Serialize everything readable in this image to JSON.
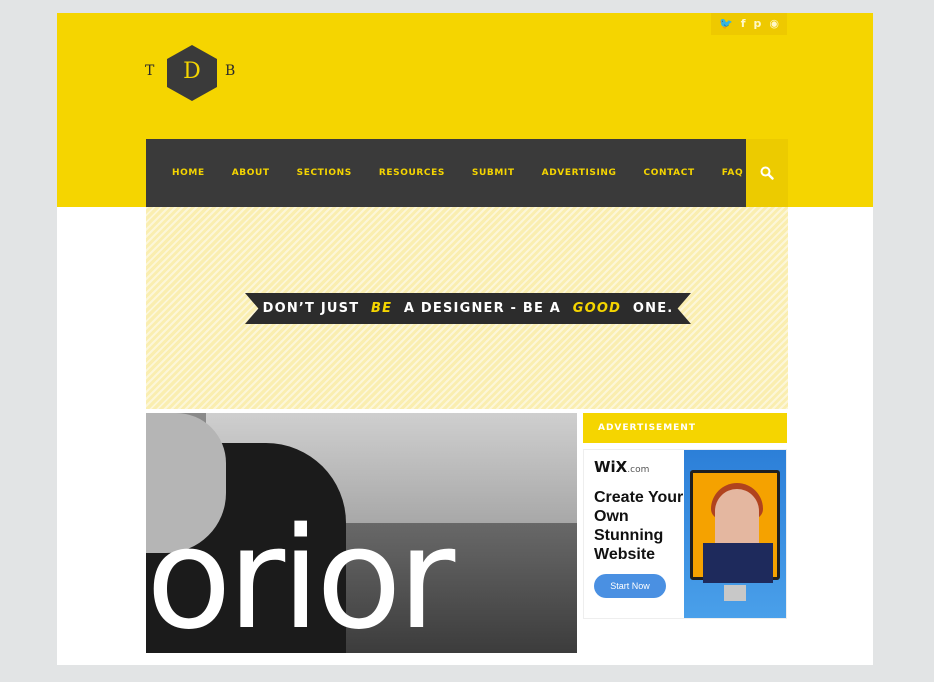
{
  "social": {
    "icons": [
      "twitter-icon",
      "facebook-icon",
      "pinterest-icon",
      "rss-icon"
    ],
    "glyphs": [
      "t",
      "f",
      "p",
      "r"
    ]
  },
  "logo": {
    "left": "T",
    "center": "D",
    "right": "B"
  },
  "nav": {
    "items": [
      "HOME",
      "ABOUT",
      "SECTIONS",
      "RESOURCES",
      "SUBMIT",
      "ADVERTISING",
      "CONTACT",
      "FAQ"
    ],
    "search_icon": "search-icon"
  },
  "banner": {
    "part1": "DON’T JUST ",
    "em1": "BE",
    "part2": " A DESIGNER - BE A ",
    "em2": "GOOD",
    "part3": " ONE."
  },
  "feature": {
    "word": "orior"
  },
  "sidebar": {
    "ad_label": "ADVERTISEMENT",
    "ad": {
      "brand": "WiX",
      "brand_suffix": ".com",
      "headline": "Create Your Own Stunning Website",
      "button": "Start Now"
    }
  },
  "colors": {
    "brand_yellow": "#f5d500",
    "nav_dark": "#3a3a3a",
    "banner_bg": "#faeeb0",
    "ad_button": "#4a90e2"
  }
}
